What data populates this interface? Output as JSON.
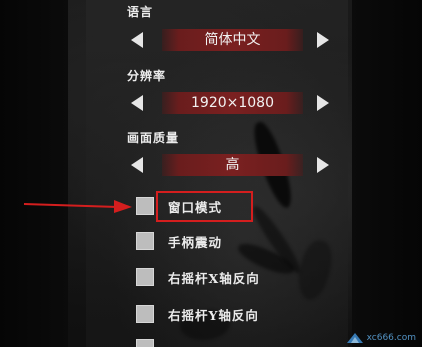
{
  "settings": {
    "language": {
      "label": "语言",
      "value": "简体中文"
    },
    "resolution": {
      "label": "分辨率",
      "value": "1920×1080"
    },
    "quality": {
      "label": "画面质量",
      "value": "高"
    }
  },
  "checkboxes": [
    {
      "label": "窗口模式",
      "checked": false,
      "highlighted": true
    },
    {
      "label": "手柄震动",
      "checked": false,
      "highlighted": false
    },
    {
      "label": "右摇杆X轴反向",
      "checked": false,
      "highlighted": false
    },
    {
      "label": "右摇杆Y轴反向",
      "checked": false,
      "highlighted": false
    }
  ],
  "annotation": {
    "color": "#d41e1e"
  },
  "watermark": {
    "text": "xc666.com"
  },
  "colors": {
    "value_box": "#7a2020",
    "arrow": "#e6e6e6",
    "checkbox": "#bdbdbd",
    "annotation": "#d41e1e"
  }
}
